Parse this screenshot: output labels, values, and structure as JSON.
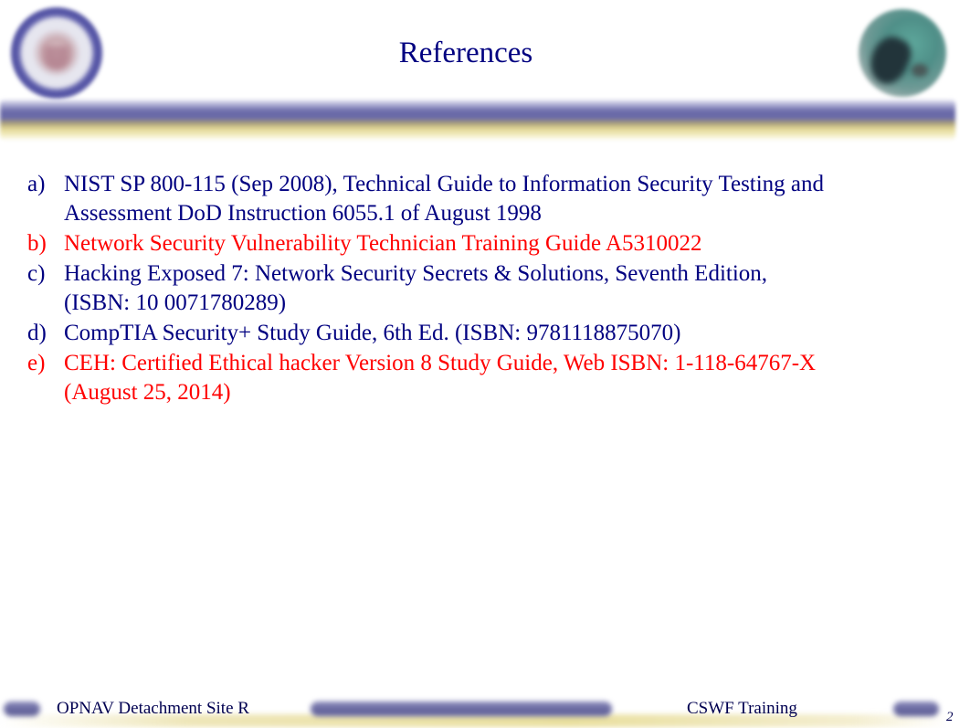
{
  "slide": {
    "title": "References",
    "references": [
      {
        "marker": "a)",
        "lines": [
          "NIST SP 800-115 (Sep 2008), Technical Guide to Information Security Testing and",
          "Assessment DoD Instruction 6055.1 of August 1998"
        ],
        "color": "#000080"
      },
      {
        "marker": "b)",
        "lines": [
          "Network Security Vulnerability Technician Training Guide A5310022"
        ],
        "color": "#ff0000"
      },
      {
        "marker": "c)",
        "lines": [
          "Hacking Exposed 7: Network Security Secrets & Solutions, Seventh Edition,",
          "(ISBN: 10 0071780289)"
        ],
        "color": "#000080"
      },
      {
        "marker": "d)",
        "lines": [
          "CompTIA Security+ Study Guide, 6th Ed. (ISBN: 9781118875070)"
        ],
        "color": "#000080"
      },
      {
        "marker": "e)",
        "lines": [
          "CEH: Certified Ethical hacker Version 8 Study Guide, Web ISBN: 1-118-64767-X",
          "(August 25, 2014)"
        ],
        "color": "#ff0000"
      }
    ]
  },
  "header": {
    "left_logo": "navy-seal-icon",
    "right_logo": "globe-icon"
  },
  "footer": {
    "left_text": "OPNAV Detachment Site R",
    "right_text": "CSWF Training",
    "page_number": "2"
  },
  "colors": {
    "title": "#000080",
    "body_navy": "#000080",
    "body_red": "#ff0000",
    "band_blue": "#6a6aa8",
    "band_yellow": "#e3d896"
  }
}
